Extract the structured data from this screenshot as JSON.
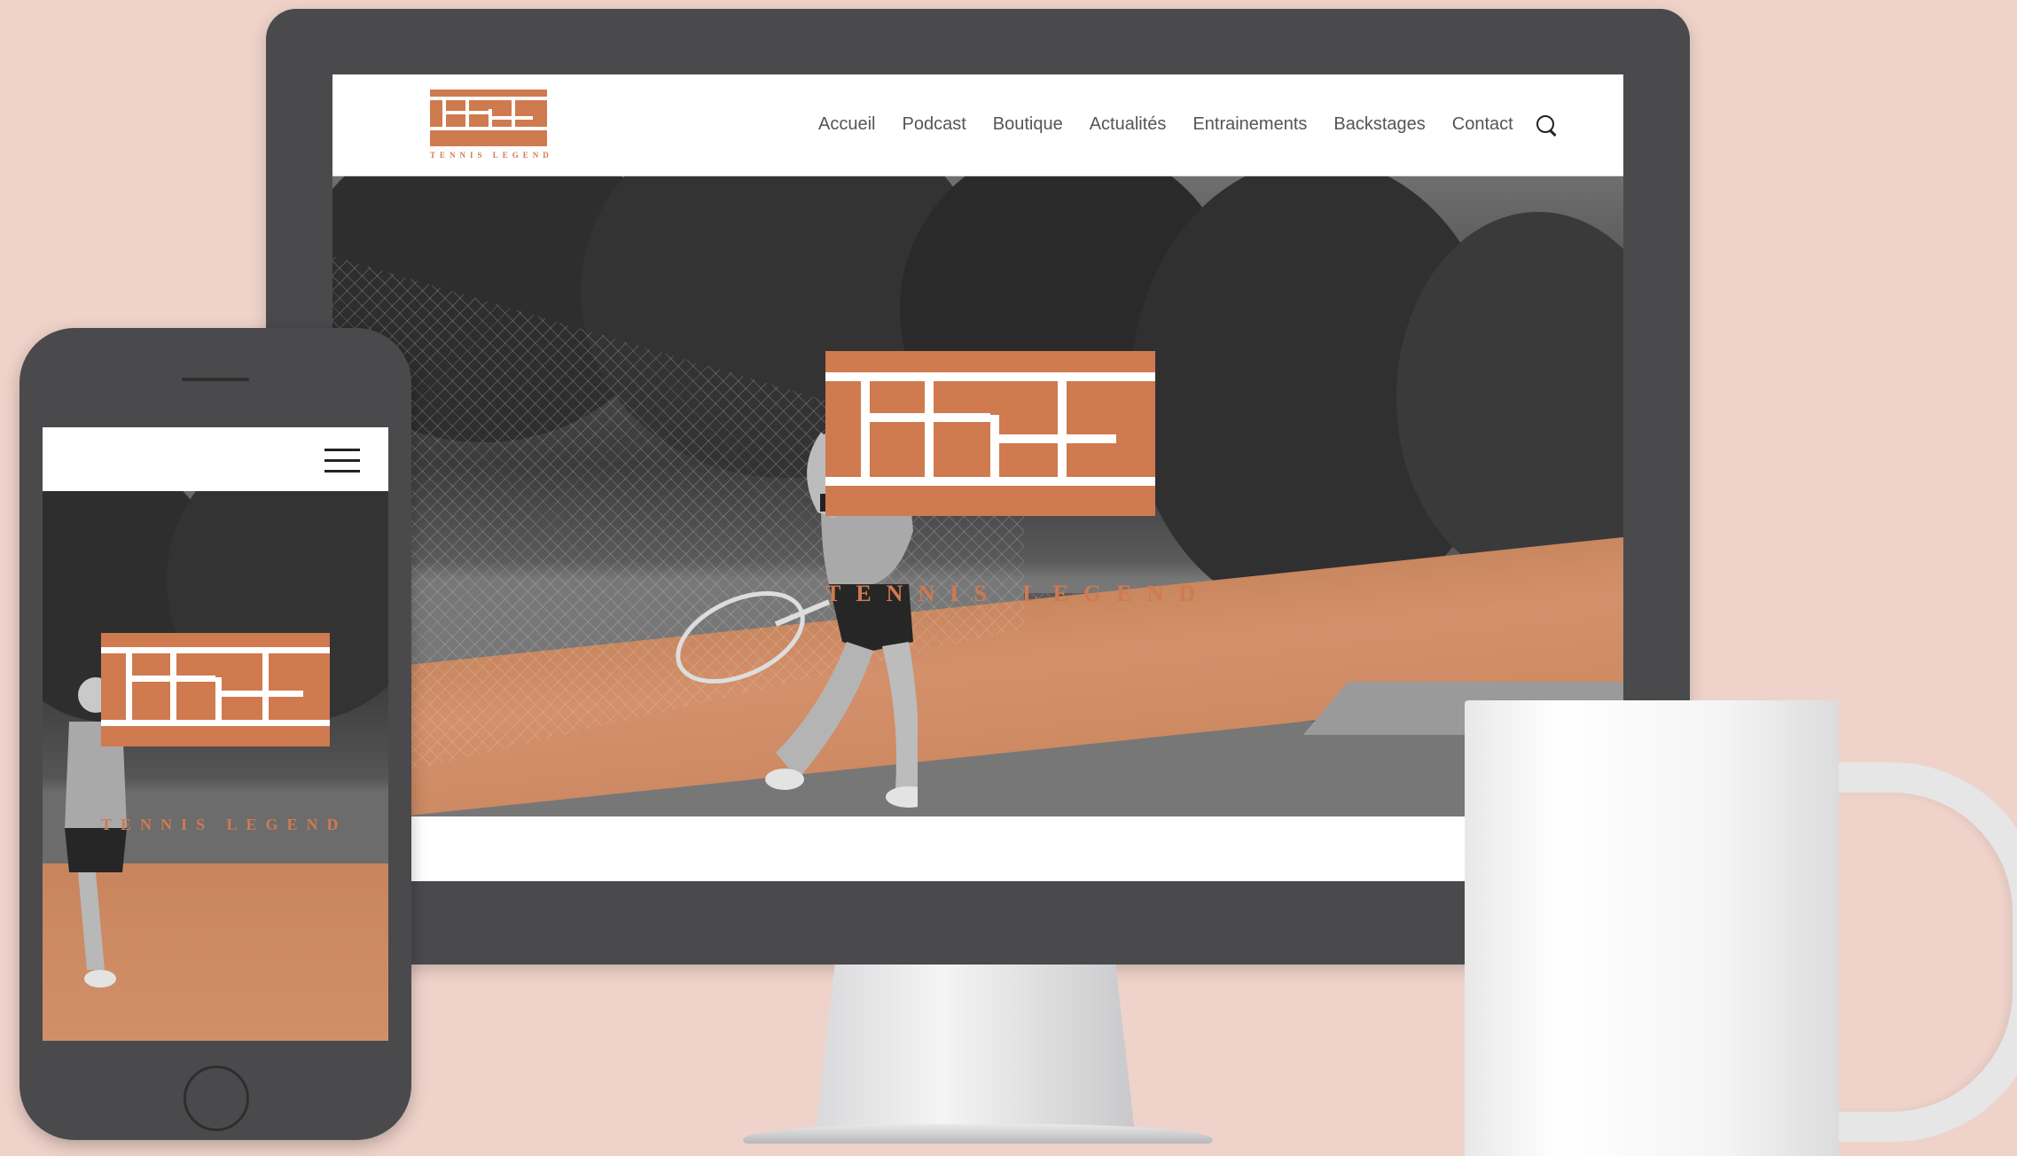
{
  "site": {
    "brand_name": "TENNIS LEGEND",
    "brand_color": "#d07a4f"
  },
  "desktop": {
    "nav": [
      {
        "label": "Accueil"
      },
      {
        "label": "Podcast"
      },
      {
        "label": "Boutique"
      },
      {
        "label": "Actualités"
      },
      {
        "label": "Entrainements"
      },
      {
        "label": "Backstages"
      },
      {
        "label": "Contact"
      }
    ],
    "search_icon": "search-icon"
  },
  "mobile": {
    "menu_icon": "hamburger-icon"
  }
}
